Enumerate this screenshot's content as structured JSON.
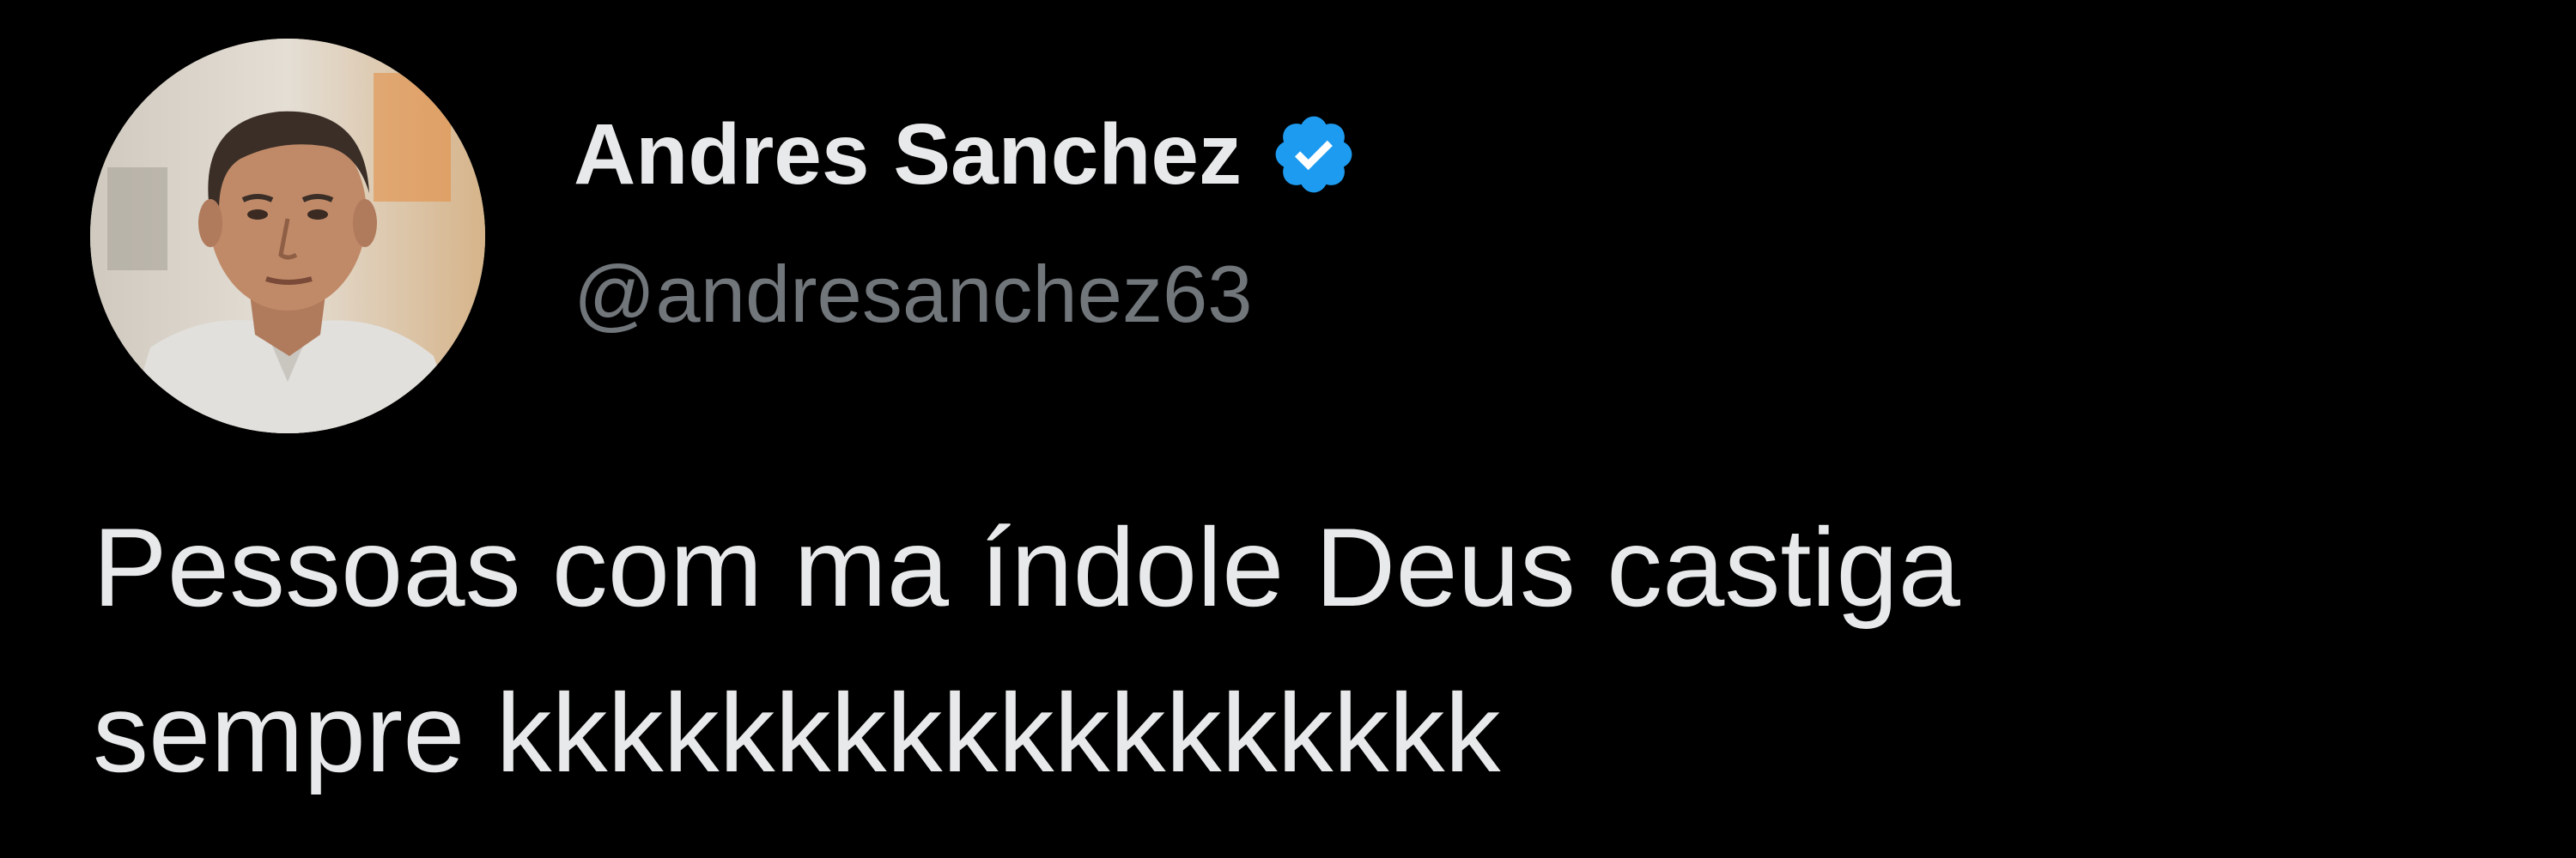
{
  "author": {
    "display_name": "Andres Sanchez",
    "handle": "@andresanchez63",
    "verified": true,
    "verified_icon": "verified-badge-icon",
    "verified_color": "#1d9bf0"
  },
  "tweet": {
    "text": "Pessoas com ma índole Deus castiga\nsempre kkkkkkkkkkkkkkkkkk"
  },
  "colors": {
    "background": "#000000",
    "primary_text": "#e7e9ea",
    "secondary_text": "#71767b"
  }
}
